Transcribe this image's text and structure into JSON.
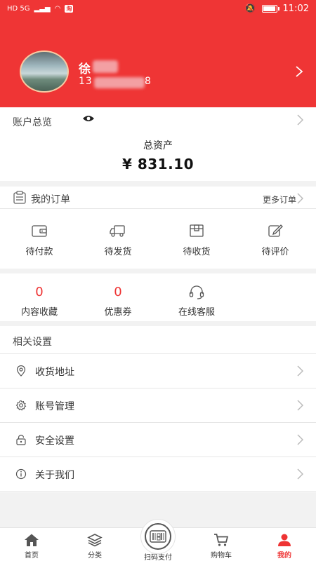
{
  "status_bar": {
    "time": "11:02",
    "network": "HD 5G",
    "app_chip": "淘"
  },
  "profile": {
    "name": "徐",
    "phone": "13",
    "phone_tail": "8"
  },
  "overview": {
    "title": "账户总览",
    "total_label": "总资产",
    "total_value": "¥ 831.10"
  },
  "orders": {
    "title": "我的订单",
    "more_label": "更多订单",
    "items": [
      {
        "label": "待付款",
        "icon": "wallet-icon"
      },
      {
        "label": "待发货",
        "icon": "truck-icon"
      },
      {
        "label": "待收货",
        "icon": "package-icon"
      },
      {
        "label": "待评价",
        "icon": "edit-icon"
      }
    ]
  },
  "stats": {
    "items": [
      {
        "value": "0",
        "label": "内容收藏"
      },
      {
        "value": "0",
        "label": "优惠券"
      },
      {
        "label": "在线客服",
        "icon": "headset-icon"
      }
    ]
  },
  "settings": {
    "title": "相关设置",
    "items": [
      {
        "label": "收货地址",
        "icon": "location-icon"
      },
      {
        "label": "账号管理",
        "icon": "gear-icon"
      },
      {
        "label": "安全设置",
        "icon": "lock-icon"
      },
      {
        "label": "关于我们",
        "icon": "info-icon"
      }
    ]
  },
  "tabbar": {
    "items": [
      {
        "label": "首页",
        "icon": "home-icon"
      },
      {
        "label": "分类",
        "icon": "layers-icon"
      },
      {
        "label": "扫码支付",
        "icon": "scan-icon"
      },
      {
        "label": "购物车",
        "icon": "cart-icon"
      },
      {
        "label": "我的",
        "icon": "person-icon",
        "active": true
      }
    ]
  },
  "colors": {
    "brand_red": "#ef3535",
    "accent_red": "#e33333"
  }
}
